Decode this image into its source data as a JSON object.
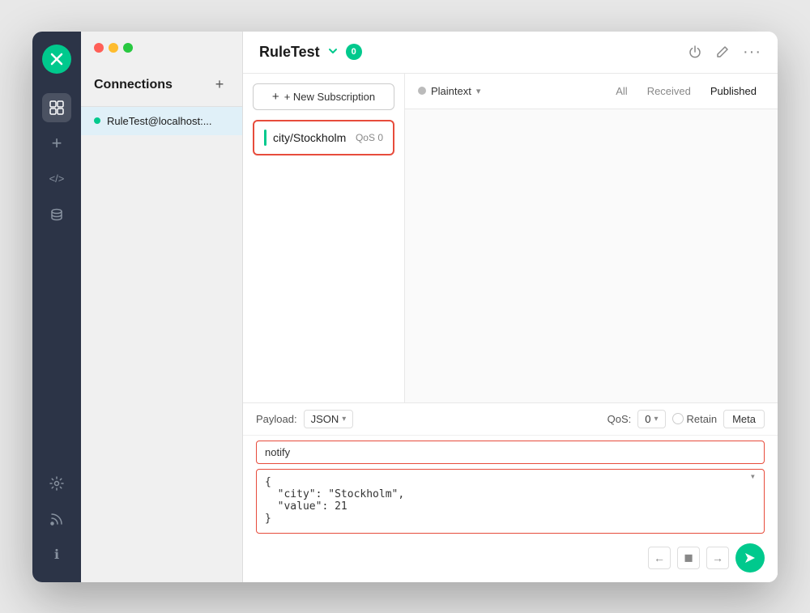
{
  "window": {
    "traffic_lights": [
      "close",
      "minimize",
      "maximize"
    ]
  },
  "sidebar": {
    "logo_icon": "✕",
    "items": [
      {
        "id": "connections",
        "icon": "⧉",
        "active": true
      },
      {
        "id": "add",
        "icon": "+"
      },
      {
        "id": "code",
        "icon": "</>"
      },
      {
        "id": "database",
        "icon": "▤"
      },
      {
        "id": "settings",
        "icon": "⚙"
      },
      {
        "id": "rss",
        "icon": "☁"
      },
      {
        "id": "info",
        "icon": "ℹ"
      }
    ]
  },
  "connections_panel": {
    "title": "Connections",
    "add_icon": "+",
    "items": [
      {
        "id": "rultest",
        "label": "RuleTest@localhost:...",
        "status": "connected"
      }
    ]
  },
  "topbar": {
    "title": "RuleTest",
    "badge": "0",
    "chevron": "⌄",
    "actions": [
      "power",
      "edit",
      "more"
    ]
  },
  "subscriptions": {
    "new_btn_label": "+ New Subscription",
    "items": [
      {
        "topic": "city/Stockholm",
        "qos": "QoS 0"
      }
    ]
  },
  "message_panel": {
    "plaintext_label": "Plaintext",
    "filter_tabs": [
      {
        "label": "All",
        "active": false
      },
      {
        "label": "Received",
        "active": false
      },
      {
        "label": "Published",
        "active": true
      }
    ]
  },
  "compose": {
    "payload_label": "Payload:",
    "payload_format": "JSON",
    "qos_label": "QoS:",
    "qos_value": "0",
    "retain_label": "Retain",
    "meta_label": "Meta",
    "topic_value": "notify",
    "payload_value": "{\n  \"city\": \"Stockholm\",\n  \"value\": 21\n}"
  }
}
